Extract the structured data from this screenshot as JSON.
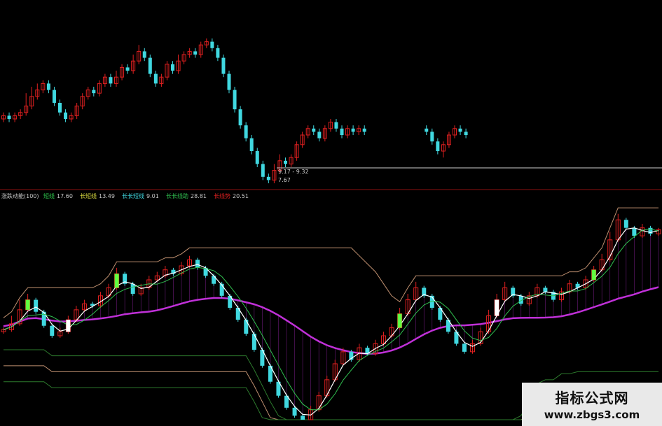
{
  "colors": {
    "background": "#000000",
    "up": "#e02020",
    "down": "#40d8e0",
    "ma_white": "#ffffff",
    "ma_green": "#30c050",
    "band_magenta": "#c030d8",
    "band_tan": "#c09070",
    "band_dark_green": "#2d7a2d",
    "highlight_green": "#60ff40",
    "highlight_white": "#ffffff"
  },
  "indicator_header": {
    "name": "涨跌动能(100)",
    "items": [
      {
        "label": "短线",
        "value": "17.60",
        "color": "#30d050"
      },
      {
        "label": "长短线",
        "value": "13.49",
        "color": "#e0e040"
      },
      {
        "label": "长长短线",
        "value": "9.01",
        "color": "#40d8e0"
      },
      {
        "label": "长长线助",
        "value": "28.81",
        "color": "#30c050"
      },
      {
        "label": "长线势",
        "value": "20.51",
        "color": "#e02020"
      }
    ]
  },
  "price_annotations": {
    "high_low_text": "9.17 - 9.32",
    "low_price": "7.67"
  },
  "watermark": {
    "title": "指标公式网",
    "url": "www.zbgs3.com"
  },
  "chart_data": [
    {
      "type": "candlestick",
      "panel": "main",
      "note": "approximate relative price levels; no price axis printed",
      "candles": [
        {
          "o": 20,
          "c": 21,
          "h": 22,
          "l": 19
        },
        {
          "o": 21,
          "c": 20,
          "h": 22,
          "l": 19
        },
        {
          "o": 20,
          "c": 21,
          "h": 22,
          "l": 19
        },
        {
          "o": 21,
          "c": 22,
          "h": 23,
          "l": 20
        },
        {
          "o": 22,
          "c": 24,
          "h": 28,
          "l": 21
        },
        {
          "o": 24,
          "c": 27,
          "h": 30,
          "l": 23
        },
        {
          "o": 27,
          "c": 29,
          "h": 31,
          "l": 26
        },
        {
          "o": 29,
          "c": 31,
          "h": 32,
          "l": 28
        },
        {
          "o": 31,
          "c": 29,
          "h": 32,
          "l": 28
        },
        {
          "o": 29,
          "c": 25,
          "h": 30,
          "l": 24
        },
        {
          "o": 25,
          "c": 22,
          "h": 26,
          "l": 21
        },
        {
          "o": 22,
          "c": 20,
          "h": 23,
          "l": 19
        },
        {
          "o": 20,
          "c": 21,
          "h": 22,
          "l": 19
        },
        {
          "o": 21,
          "c": 24,
          "h": 25,
          "l": 20
        },
        {
          "o": 24,
          "c": 27,
          "h": 28,
          "l": 23
        },
        {
          "o": 27,
          "c": 29,
          "h": 30,
          "l": 26
        },
        {
          "o": 29,
          "c": 28,
          "h": 30,
          "l": 27
        },
        {
          "o": 28,
          "c": 31,
          "h": 32,
          "l": 27
        },
        {
          "o": 31,
          "c": 33,
          "h": 34,
          "l": 30
        },
        {
          "o": 33,
          "c": 31,
          "h": 34,
          "l": 30
        },
        {
          "o": 31,
          "c": 33,
          "h": 35,
          "l": 30
        },
        {
          "o": 33,
          "c": 36,
          "h": 37,
          "l": 32
        },
        {
          "o": 36,
          "c": 35,
          "h": 37,
          "l": 34
        },
        {
          "o": 35,
          "c": 38,
          "h": 40,
          "l": 34
        },
        {
          "o": 38,
          "c": 41,
          "h": 43,
          "l": 37
        },
        {
          "o": 41,
          "c": 39,
          "h": 42,
          "l": 38
        },
        {
          "o": 39,
          "c": 34,
          "h": 40,
          "l": 33
        },
        {
          "o": 34,
          "c": 31,
          "h": 35,
          "l": 30
        },
        {
          "o": 31,
          "c": 33,
          "h": 34,
          "l": 30
        },
        {
          "o": 33,
          "c": 37,
          "h": 38,
          "l": 32
        },
        {
          "o": 37,
          "c": 35,
          "h": 38,
          "l": 34
        },
        {
          "o": 35,
          "c": 38,
          "h": 40,
          "l": 34
        },
        {
          "o": 38,
          "c": 40,
          "h": 41,
          "l": 37
        },
        {
          "o": 40,
          "c": 41,
          "h": 42,
          "l": 39
        },
        {
          "o": 41,
          "c": 40,
          "h": 42,
          "l": 39
        },
        {
          "o": 40,
          "c": 43,
          "h": 44,
          "l": 39
        },
        {
          "o": 43,
          "c": 44,
          "h": 45,
          "l": 42
        },
        {
          "o": 44,
          "c": 42,
          "h": 45,
          "l": 41
        },
        {
          "o": 42,
          "c": 39,
          "h": 43,
          "l": 38
        },
        {
          "o": 39,
          "c": 34,
          "h": 40,
          "l": 33
        },
        {
          "o": 34,
          "c": 29,
          "h": 35,
          "l": 28
        },
        {
          "o": 29,
          "c": 23,
          "h": 30,
          "l": 22
        },
        {
          "o": 23,
          "c": 18,
          "h": 24,
          "l": 17
        },
        {
          "o": 18,
          "c": 14,
          "h": 19,
          "l": 13
        },
        {
          "o": 14,
          "c": 10,
          "h": 15,
          "l": 9
        },
        {
          "o": 10,
          "c": 6,
          "h": 11,
          "l": 5
        },
        {
          "o": 6,
          "c": 2,
          "h": 7,
          "l": 1
        },
        {
          "o": 2,
          "c": 1,
          "h": 3,
          "l": 0
        },
        {
          "o": 1,
          "c": 4,
          "h": 6,
          "l": 0
        },
        {
          "o": 4,
          "c": 7,
          "h": 9,
          "l": 3
        },
        {
          "o": 7,
          "c": 6,
          "h": 8,
          "l": 5
        },
        {
          "o": 6,
          "c": 8,
          "h": 9,
          "l": 5
        },
        {
          "o": 8,
          "c": 12,
          "h": 13,
          "l": 7
        },
        {
          "o": 12,
          "c": 15,
          "h": 16,
          "l": 11
        },
        {
          "o": 15,
          "c": 17,
          "h": 18,
          "l": 14
        },
        {
          "o": 17,
          "c": 16,
          "h": 18,
          "l": 15
        },
        {
          "o": 16,
          "c": 14,
          "h": 17,
          "l": 13
        },
        {
          "o": 14,
          "c": 17,
          "h": 18,
          "l": 13
        },
        {
          "o": 17,
          "c": 19,
          "h": 20,
          "l": 16
        },
        {
          "o": 19,
          "c": 17,
          "h": 20,
          "l": 16
        },
        {
          "o": 17,
          "c": 15,
          "h": 18,
          "l": 14
        },
        {
          "o": 15,
          "c": 17,
          "h": 18,
          "l": 14
        },
        {
          "o": 17,
          "c": 16,
          "h": 18,
          "l": 15
        },
        {
          "o": 16,
          "c": 17,
          "h": 18,
          "l": 15
        },
        {
          "o": 17,
          "c": 16,
          "h": 18,
          "l": 15
        },
        null,
        null,
        null,
        null,
        null,
        null,
        null,
        null,
        null,
        null,
        {
          "o": 17,
          "c": 16,
          "h": 18,
          "l": 15
        },
        {
          "o": 16,
          "c": 13,
          "h": 17,
          "l": 12
        },
        {
          "o": 13,
          "c": 10,
          "h": 14,
          "l": 9
        },
        {
          "o": 10,
          "c": 12,
          "h": 13,
          "l": 8
        },
        {
          "o": 12,
          "c": 15,
          "h": 16,
          "l": 11
        },
        {
          "o": 15,
          "c": 17,
          "h": 18,
          "l": 14
        },
        {
          "o": 17,
          "c": 16,
          "h": 18,
          "l": 15
        },
        {
          "o": 16,
          "c": 15,
          "h": 17,
          "l": 14
        }
      ]
    },
    {
      "type": "candlestick",
      "panel": "indicator",
      "note": "approximate relative levels; no axis printed",
      "candles": [
        {
          "o": 44,
          "c": 45,
          "h": 46,
          "l": 43
        },
        {
          "o": 45,
          "c": 48,
          "h": 52,
          "l": 44
        },
        {
          "o": 48,
          "c": 55,
          "h": 60,
          "l": 47
        },
        {
          "o": 55,
          "c": 60,
          "h": 63,
          "l": 54
        },
        {
          "o": 60,
          "c": 54,
          "h": 61,
          "l": 53
        },
        {
          "o": 54,
          "c": 47,
          "h": 55,
          "l": 46
        },
        {
          "o": 47,
          "c": 42,
          "h": 48,
          "l": 41
        },
        {
          "o": 42,
          "c": 44,
          "h": 46,
          "l": 41
        },
        {
          "o": 44,
          "c": 50,
          "h": 52,
          "l": 43
        },
        {
          "o": 50,
          "c": 55,
          "h": 57,
          "l": 49
        },
        {
          "o": 55,
          "c": 58,
          "h": 60,
          "l": 54
        },
        {
          "o": 58,
          "c": 57,
          "h": 59,
          "l": 56
        },
        {
          "o": 57,
          "c": 62,
          "h": 64,
          "l": 56
        },
        {
          "o": 62,
          "c": 66,
          "h": 68,
          "l": 61
        },
        {
          "o": 66,
          "c": 73,
          "h": 76,
          "l": 65
        },
        {
          "o": 73,
          "c": 68,
          "h": 74,
          "l": 67
        },
        {
          "o": 68,
          "c": 63,
          "h": 69,
          "l": 62
        },
        {
          "o": 63,
          "c": 66,
          "h": 68,
          "l": 62
        },
        {
          "o": 66,
          "c": 70,
          "h": 72,
          "l": 65
        },
        {
          "o": 70,
          "c": 72,
          "h": 74,
          "l": 69
        },
        {
          "o": 72,
          "c": 75,
          "h": 77,
          "l": 71
        },
        {
          "o": 75,
          "c": 73,
          "h": 76,
          "l": 72
        },
        {
          "o": 73,
          "c": 77,
          "h": 79,
          "l": 72
        },
        {
          "o": 77,
          "c": 80,
          "h": 82,
          "l": 76
        },
        {
          "o": 80,
          "c": 76,
          "h": 81,
          "l": 75
        },
        {
          "o": 76,
          "c": 72,
          "h": 77,
          "l": 71
        },
        {
          "o": 72,
          "c": 68,
          "h": 73,
          "l": 67
        },
        {
          "o": 68,
          "c": 62,
          "h": 69,
          "l": 61
        },
        {
          "o": 62,
          "c": 56,
          "h": 63,
          "l": 55
        },
        {
          "o": 56,
          "c": 50,
          "h": 57,
          "l": 49
        },
        {
          "o": 50,
          "c": 43,
          "h": 51,
          "l": 42
        },
        {
          "o": 43,
          "c": 35,
          "h": 44,
          "l": 34
        },
        {
          "o": 35,
          "c": 27,
          "h": 36,
          "l": 26
        },
        {
          "o": 27,
          "c": 19,
          "h": 28,
          "l": 18
        },
        {
          "o": 19,
          "c": 12,
          "h": 20,
          "l": 11
        },
        {
          "o": 12,
          "c": 6,
          "h": 13,
          "l": 5
        },
        {
          "o": 6,
          "c": 2,
          "h": 7,
          "l": 1
        },
        {
          "o": 2,
          "c": 0,
          "h": 3,
          "l": 0
        },
        {
          "o": 0,
          "c": 5,
          "h": 7,
          "l": 0
        },
        {
          "o": 5,
          "c": 12,
          "h": 14,
          "l": 4
        },
        {
          "o": 12,
          "c": 20,
          "h": 22,
          "l": 11
        },
        {
          "o": 20,
          "c": 28,
          "h": 30,
          "l": 19
        },
        {
          "o": 28,
          "c": 34,
          "h": 36,
          "l": 27
        },
        {
          "o": 34,
          "c": 30,
          "h": 35,
          "l": 29
        },
        {
          "o": 30,
          "c": 36,
          "h": 38,
          "l": 29
        },
        {
          "o": 36,
          "c": 33,
          "h": 37,
          "l": 32
        },
        {
          "o": 33,
          "c": 38,
          "h": 40,
          "l": 32
        },
        {
          "o": 38,
          "c": 42,
          "h": 44,
          "l": 37
        },
        {
          "o": 42,
          "c": 46,
          "h": 48,
          "l": 41
        },
        {
          "o": 46,
          "c": 53,
          "h": 56,
          "l": 45
        },
        {
          "o": 53,
          "c": 60,
          "h": 63,
          "l": 52
        },
        {
          "o": 60,
          "c": 66,
          "h": 69,
          "l": 59
        },
        {
          "o": 66,
          "c": 62,
          "h": 67,
          "l": 61
        },
        {
          "o": 62,
          "c": 56,
          "h": 63,
          "l": 55
        },
        {
          "o": 56,
          "c": 50,
          "h": 57,
          "l": 49
        },
        {
          "o": 50,
          "c": 44,
          "h": 51,
          "l": 43
        },
        {
          "o": 44,
          "c": 38,
          "h": 45,
          "l": 37
        },
        {
          "o": 38,
          "c": 34,
          "h": 39,
          "l": 33
        },
        {
          "o": 34,
          "c": 38,
          "h": 40,
          "l": 33
        },
        {
          "o": 38,
          "c": 44,
          "h": 46,
          "l": 37
        },
        {
          "o": 44,
          "c": 52,
          "h": 55,
          "l": 43
        },
        {
          "o": 52,
          "c": 60,
          "h": 63,
          "l": 51
        },
        {
          "o": 60,
          "c": 66,
          "h": 69,
          "l": 59
        },
        {
          "o": 66,
          "c": 62,
          "h": 67,
          "l": 61
        },
        {
          "o": 62,
          "c": 58,
          "h": 63,
          "l": 57
        },
        {
          "o": 58,
          "c": 62,
          "h": 64,
          "l": 57
        },
        {
          "o": 62,
          "c": 66,
          "h": 68,
          "l": 61
        },
        {
          "o": 66,
          "c": 64,
          "h": 67,
          "l": 63
        },
        {
          "o": 64,
          "c": 60,
          "h": 65,
          "l": 59
        },
        {
          "o": 60,
          "c": 64,
          "h": 66,
          "l": 59
        },
        {
          "o": 64,
          "c": 68,
          "h": 70,
          "l": 63
        },
        {
          "o": 68,
          "c": 66,
          "h": 69,
          "l": 65
        },
        {
          "o": 66,
          "c": 70,
          "h": 72,
          "l": 65
        },
        {
          "o": 70,
          "c": 75,
          "h": 77,
          "l": 69
        },
        {
          "o": 75,
          "c": 80,
          "h": 83,
          "l": 74
        },
        {
          "o": 80,
          "c": 90,
          "h": 94,
          "l": 79
        },
        {
          "o": 90,
          "c": 100,
          "h": 103,
          "l": 89
        },
        {
          "o": 100,
          "c": 96,
          "h": 101,
          "l": 95
        },
        {
          "o": 96,
          "c": 92,
          "h": 97,
          "l": 91
        },
        {
          "o": 92,
          "c": 96,
          "h": 98,
          "l": 91
        },
        {
          "o": 96,
          "c": 93,
          "h": 97,
          "l": 92
        },
        {
          "o": 93,
          "c": 95,
          "h": 96,
          "l": 92
        }
      ]
    }
  ]
}
